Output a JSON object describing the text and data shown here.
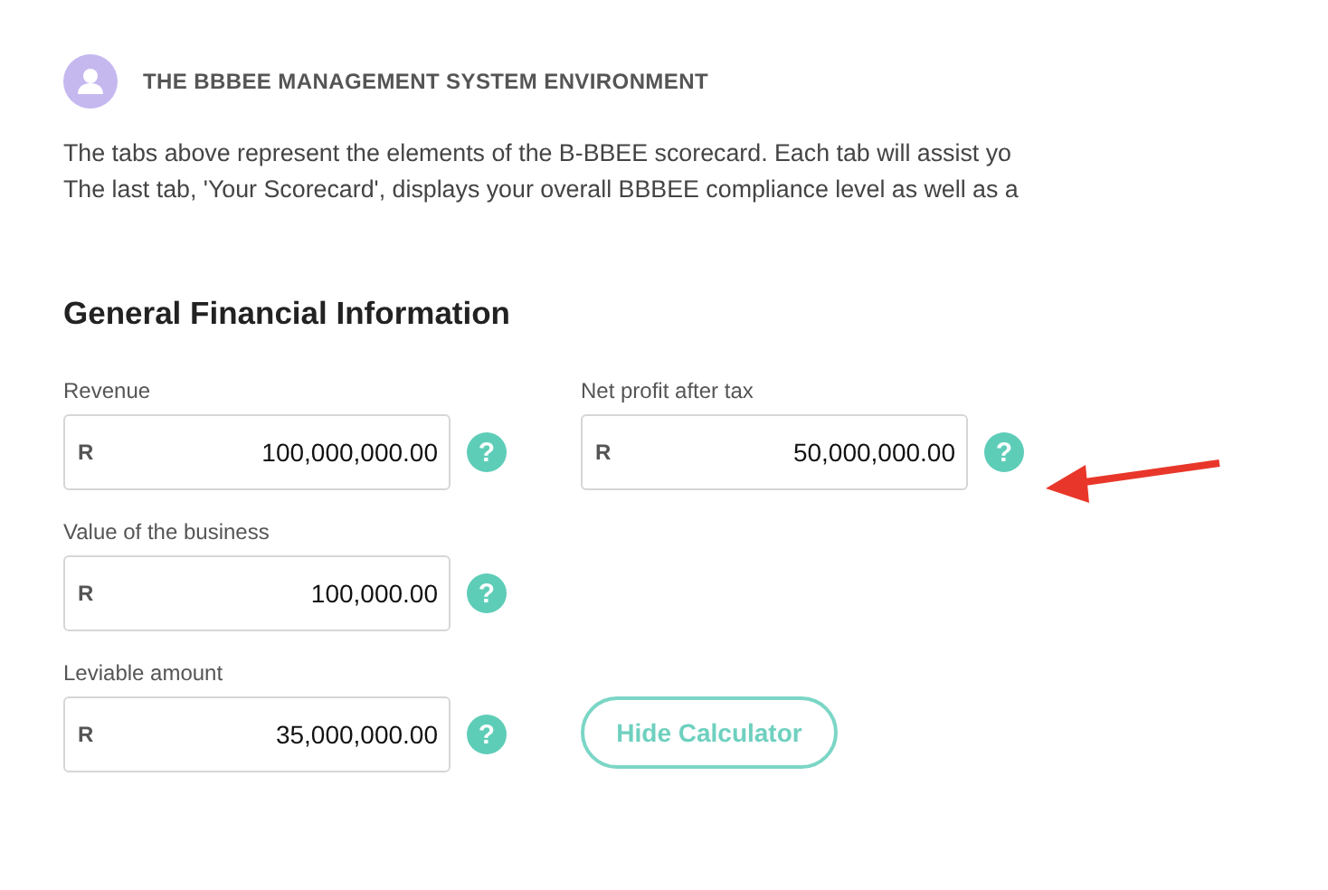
{
  "section": {
    "title": "THE BBBEE MANAGEMENT SYSTEM ENVIRONMENT"
  },
  "intro": [
    "The tabs above represent the elements of the B-BBEE scorecard. Each tab will assist yo",
    "The last tab, 'Your Scorecard', displays your overall BBBEE compliance level as well as a"
  ],
  "form": {
    "title": "General Financial Information",
    "fields": [
      {
        "label": "Revenue",
        "prefix": "R",
        "value": "100,000,000.00",
        "help": "?"
      },
      {
        "label": "Net profit after tax",
        "prefix": "R",
        "value": "50,000,000.00",
        "help": "?"
      },
      {
        "label": "Value of the business",
        "prefix": "R",
        "value": "100,000.00",
        "help": "?"
      },
      {
        "label": "Leviable amount",
        "prefix": "R",
        "value": "35,000,000.00",
        "help": "?"
      }
    ],
    "button": "Hide Calculator"
  }
}
